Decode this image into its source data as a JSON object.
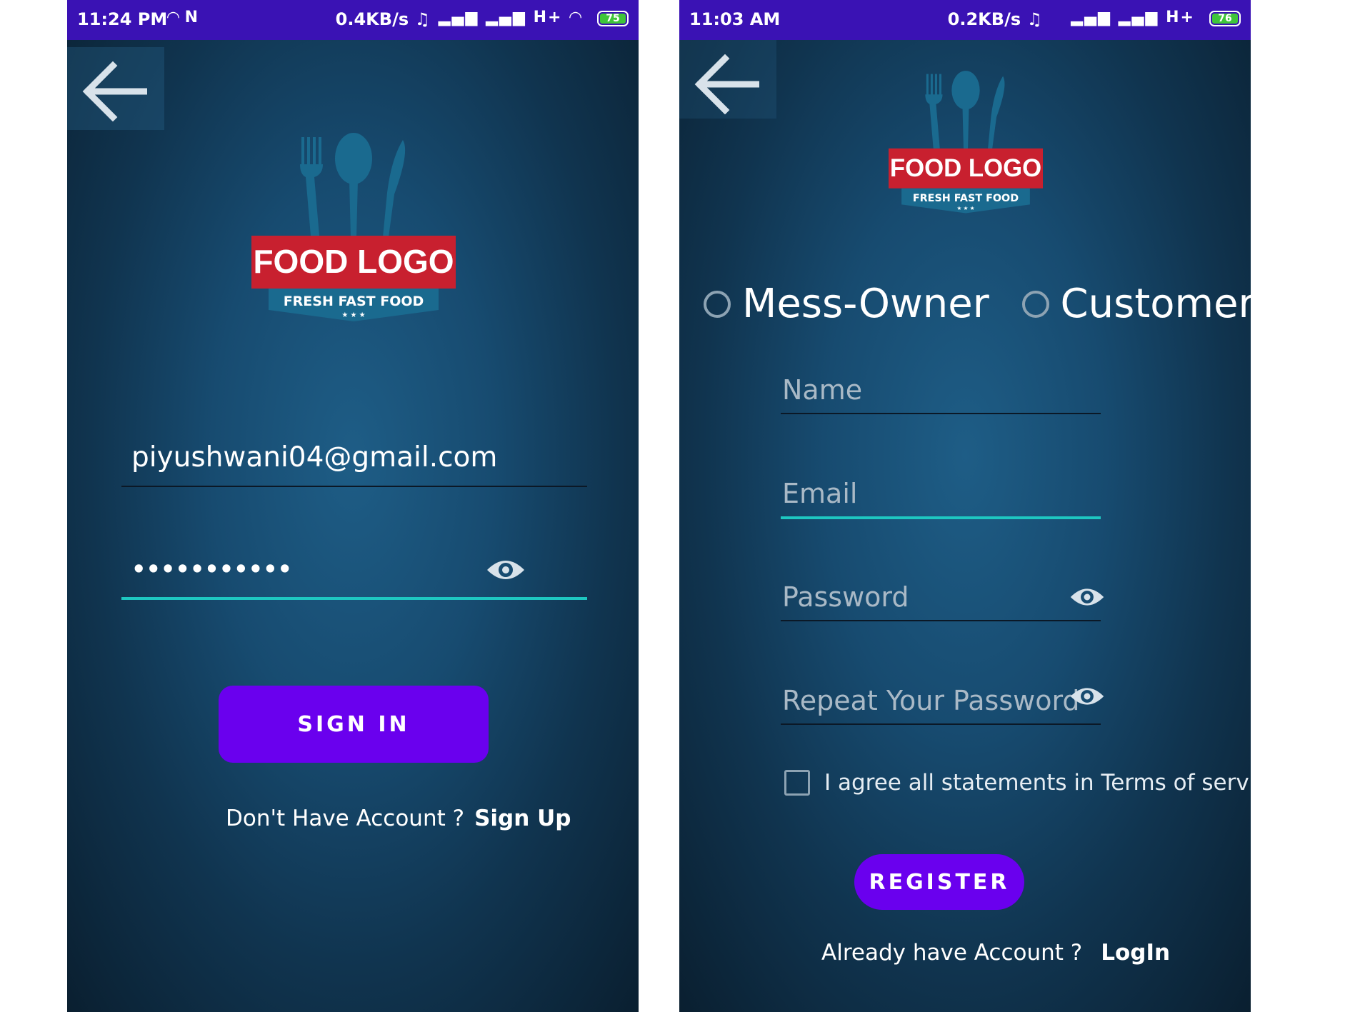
{
  "login": {
    "status_bar": {
      "time": "11:24 PM",
      "speed": "0.4KB/s",
      "network": "H+",
      "battery": "75"
    },
    "logo": {
      "brand": "FOOD LOGO",
      "tagline": "FRESH FAST FOOD"
    },
    "email_value": "piyushwani04@gmail.com",
    "password_masked": "•••••••••••",
    "sign_in_label": "SIGN IN",
    "footer_prompt": "Don't Have Account ?",
    "footer_link": "Sign Up"
  },
  "register": {
    "status_bar": {
      "time": "11:03 AM",
      "speed": "0.2KB/s",
      "network": "H+",
      "battery": "76"
    },
    "logo": {
      "brand": "FOOD LOGO",
      "tagline": "FRESH FAST FOOD"
    },
    "role_options": [
      "Mess-Owner",
      "Customer"
    ],
    "name_placeholder": "Name",
    "email_placeholder": "Email",
    "password_placeholder": "Password",
    "repeat_password_placeholder": "Repeat Your Password",
    "terms_label": "I agree all statements in Terms of service",
    "register_label": "REGISTER",
    "footer_prompt": "Already have Account ?",
    "footer_link": "LogIn"
  },
  "colors": {
    "status_bar": "#3a12b4",
    "primary_button": "#6a00ee",
    "focus_underline": "#1ec7c1",
    "logo_red": "#c8202f"
  },
  "icons": [
    "back-arrow-icon",
    "eye-icon",
    "wifi-icon",
    "signal-icon",
    "headphones-icon",
    "battery-icon"
  ]
}
